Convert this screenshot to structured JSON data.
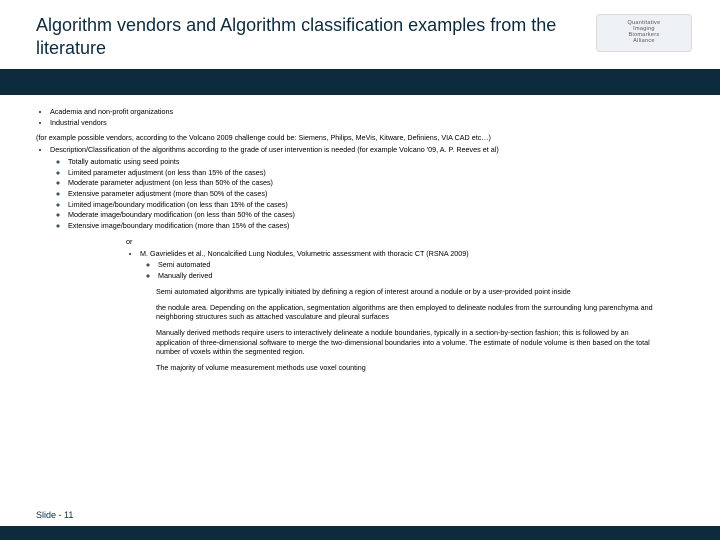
{
  "slide_number_label": "Slide - 11",
  "title": "Algorithm vendors and Algorithm classification examples from the literature",
  "logo": {
    "l1": "Quantitative",
    "l2": "Imaging",
    "l3": "Biomarkers",
    "l4": "Alliance"
  },
  "b1": "Academia and non-profit organizations",
  "b2": "Industrial vendors",
  "p_vendors": "(for example possible vendors, according to the Volcano 2009 challenge could be: Siemens, Philips, MeVis, Kitware, Definiens, VIA CAD etc…)",
  "b3_lead": "Description/Classification of the algorithms  according to the grade of user intervention is needed (for example Volcano '09, A. P. Reeves et al)",
  "b3": {
    "s1": "Totally automatic using seed points",
    "s2": "Limited parameter adjustment (on less than 15% of the cases)",
    "s3": "Moderate parameter adjustment (on less than 50% of the cases)",
    "s4": "Extensive parameter adjustment (more than 50% of the cases)",
    "s5": "Limited image/boundary modification (on less than 15% of the cases)",
    "s6": "Moderate image/boundary modification (on less than 50% of the cases)",
    "s7": "Extensive image/boundary modification (more than 15% of the cases)"
  },
  "or_label": "or",
  "b4_lead": "M. Gavrielides et al., Noncalcified Lung Nodules, Volumetric assessment with thoracic CT (RSNA 2009)",
  "b4": {
    "s1": "Semi automated",
    "s2": "Manually derived"
  },
  "para1": "Semi automated algorithms are typically initiated by defining a region of interest around a nodule or by a user-provided point inside",
  "para2": "the nodule area. Depending on the application, segmentation algorithms are then employed to delineate nodules from the surrounding lung parenchyma and neighboring structures such as attached vasculature and pleural surfaces",
  "para3": "Manually derived methods require users to interactively delineate a nodule boundaries, typically in a section-by-section fashion; this is followed by an application of three-dimensional software to merge the two-dimensional boundaries into a volume. The estimate of nodule volume is then based on the total number of voxels within the segmented region.",
  "para4": "The majority of volume measurement methods use voxel counting"
}
